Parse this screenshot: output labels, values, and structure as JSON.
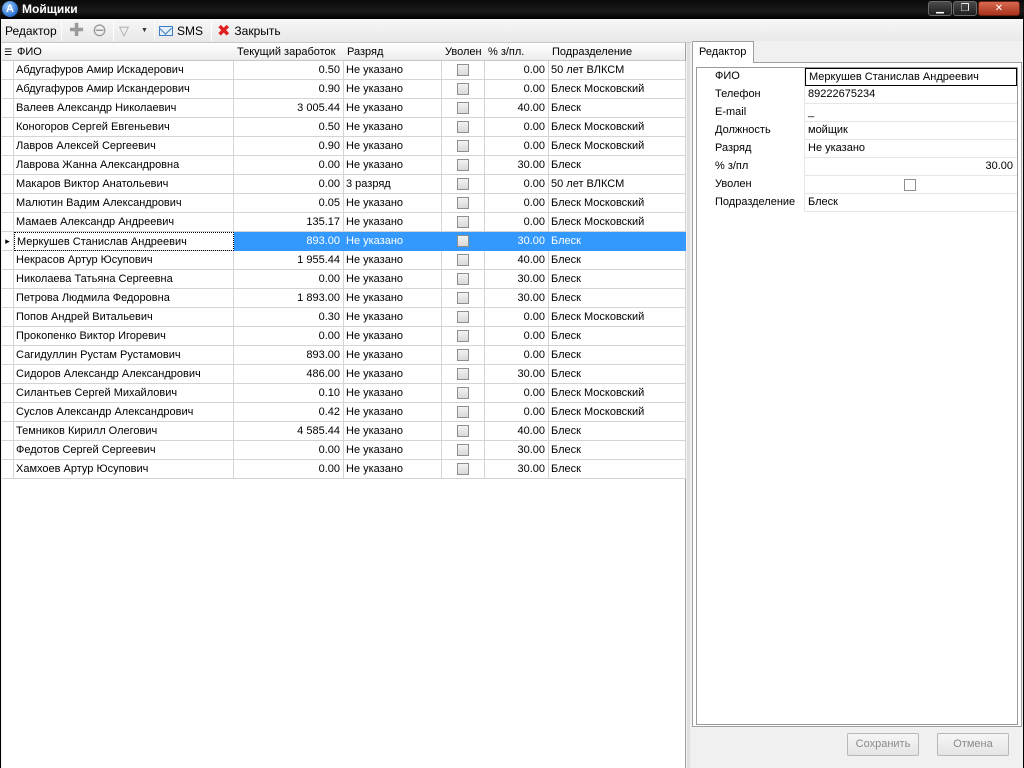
{
  "window": {
    "title": "Мойщики",
    "icon_letter": "A",
    "controls": [
      "minimize",
      "maximize",
      "close"
    ]
  },
  "toolbar": {
    "editor_label": "Редактор",
    "sms_label": "SMS",
    "close_label": "Закрыть"
  },
  "grid": {
    "columns": [
      "ФИО",
      "Текущий заработок",
      "Разряд",
      "Уволен",
      "% з/пл.",
      "Подразделение"
    ],
    "selected_index": 9,
    "rows": [
      {
        "fio": "Абдугафуров Амир Искадерович",
        "earn": "0.50",
        "rank": "Не указано",
        "fired": false,
        "pct": "0.00",
        "dept": "50 лет ВЛКСМ"
      },
      {
        "fio": "Абдугафуров Амир Искандерович",
        "earn": "0.90",
        "rank": "Не указано",
        "fired": false,
        "pct": "0.00",
        "dept": "Блеск Московский"
      },
      {
        "fio": "Валеев Александр Николаевич",
        "earn": "3 005.44",
        "rank": "Не указано",
        "fired": false,
        "pct": "40.00",
        "dept": "Блеск"
      },
      {
        "fio": "Коногоров Сергей Евгеньевич",
        "earn": "0.50",
        "rank": "Не указано",
        "fired": false,
        "pct": "0.00",
        "dept": "Блеск Московский"
      },
      {
        "fio": "Лавров Алексей Сергеевич",
        "earn": "0.90",
        "rank": "Не указано",
        "fired": false,
        "pct": "0.00",
        "dept": "Блеск Московский"
      },
      {
        "fio": "Лаврова Жанна Александровна",
        "earn": "0.00",
        "rank": "Не указано",
        "fired": false,
        "pct": "30.00",
        "dept": "Блеск"
      },
      {
        "fio": "Макаров Виктор Анатольевич",
        "earn": "0.00",
        "rank": "3 разряд",
        "fired": false,
        "pct": "0.00",
        "dept": "50 лет ВЛКСМ"
      },
      {
        "fio": "Малютин Вадим Александрович",
        "earn": "0.05",
        "rank": "Не указано",
        "fired": false,
        "pct": "0.00",
        "dept": "Блеск Московский"
      },
      {
        "fio": "Мамаев Александр Андреевич",
        "earn": "135.17",
        "rank": "Не указано",
        "fired": false,
        "pct": "0.00",
        "dept": "Блеск Московский"
      },
      {
        "fio": "Меркушев Станислав Андреевич",
        "earn": "893.00",
        "rank": "Не указано",
        "fired": false,
        "pct": "30.00",
        "dept": "Блеск"
      },
      {
        "fio": "Некрасов Артур Юсупович",
        "earn": "1 955.44",
        "rank": "Не указано",
        "fired": false,
        "pct": "40.00",
        "dept": "Блеск"
      },
      {
        "fio": "Николаева Татьяна Сергеевна",
        "earn": "0.00",
        "rank": "Не указано",
        "fired": false,
        "pct": "30.00",
        "dept": "Блеск"
      },
      {
        "fio": "Петрова Людмила Федоровна",
        "earn": "1 893.00",
        "rank": "Не указано",
        "fired": false,
        "pct": "30.00",
        "dept": "Блеск"
      },
      {
        "fio": "Попов Андрей Витальевич",
        "earn": "0.30",
        "rank": "Не указано",
        "fired": false,
        "pct": "0.00",
        "dept": "Блеск Московский"
      },
      {
        "fio": "Прокопенко Виктор Игоревич",
        "earn": "0.00",
        "rank": "Не указано",
        "fired": false,
        "pct": "0.00",
        "dept": "Блеск"
      },
      {
        "fio": "Сагидуллин Рустам Рустамович",
        "earn": "893.00",
        "rank": "Не указано",
        "fired": false,
        "pct": "0.00",
        "dept": "Блеск"
      },
      {
        "fio": "Сидоров Александр Александрович",
        "earn": "486.00",
        "rank": "Не указано",
        "fired": false,
        "pct": "30.00",
        "dept": "Блеск"
      },
      {
        "fio": "Силантьев Сергей Михайлович",
        "earn": "0.10",
        "rank": "Не указано",
        "fired": false,
        "pct": "0.00",
        "dept": "Блеск Московский"
      },
      {
        "fio": "Суслов Александр Александрович",
        "earn": "0.42",
        "rank": "Не указано",
        "fired": false,
        "pct": "0.00",
        "dept": "Блеск Московский"
      },
      {
        "fio": "Темников Кирилл Олегович",
        "earn": "4 585.44",
        "rank": "Не указано",
        "fired": false,
        "pct": "40.00",
        "dept": "Блеск"
      },
      {
        "fio": "Федотов Сергей Сергеевич",
        "earn": "0.00",
        "rank": "Не указано",
        "fired": false,
        "pct": "30.00",
        "dept": "Блеск"
      },
      {
        "fio": "Хамхоев Артур Юсупович",
        "earn": "0.00",
        "rank": "Не указано",
        "fired": false,
        "pct": "30.00",
        "dept": "Блеск"
      }
    ]
  },
  "editor": {
    "tab_label": "Редактор",
    "properties": [
      {
        "label": "ФИО",
        "value": "Меркушев Станислав Андреевич"
      },
      {
        "label": "Телефон",
        "value": "89222675234"
      },
      {
        "label": "E-mail",
        "value": "_"
      },
      {
        "label": "Должность",
        "value": "мойщик"
      },
      {
        "label": "Разряд",
        "value": "Не указано"
      },
      {
        "label": "% з/пл",
        "value": "30.00"
      },
      {
        "label": "Уволен",
        "value": false
      },
      {
        "label": "Подразделение",
        "value": "Блеск"
      }
    ],
    "save_label": "Сохранить",
    "cancel_label": "Отмена"
  },
  "colors": {
    "selection": "#3399ff",
    "titlebar": "#000000",
    "close_icon": "#e02020"
  }
}
